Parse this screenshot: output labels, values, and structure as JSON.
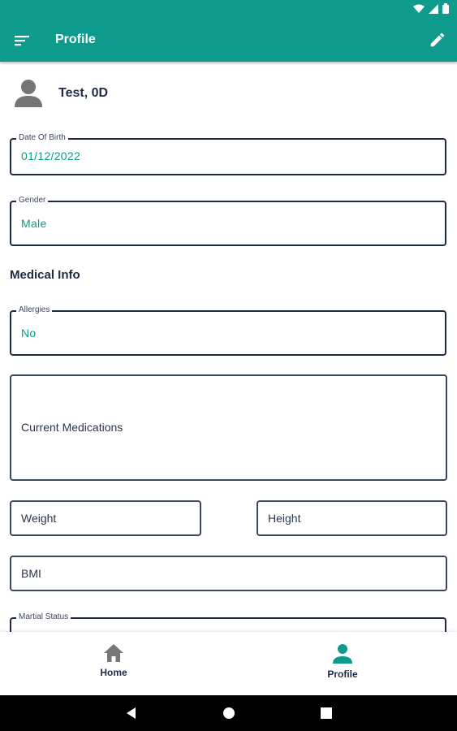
{
  "app_bar": {
    "title": "Profile",
    "menu_icon": "sort-lines-icon",
    "edit_icon": "pencil-icon"
  },
  "status_bar": {
    "icons": [
      "wifi-icon",
      "signal-icon",
      "battery-icon"
    ]
  },
  "user": {
    "name": "Test, 0D",
    "avatar_icon": "person-avatar-icon"
  },
  "fields": {
    "dob": {
      "label": "Date Of Birth",
      "value": "01/12/2022"
    },
    "gender": {
      "label": "Gender",
      "value": "Male"
    },
    "allergies": {
      "label": "Allergies",
      "value": "No"
    },
    "current_medications": {
      "placeholder": "Current Medications"
    },
    "weight": {
      "placeholder": "Weight"
    },
    "height": {
      "placeholder": "Height"
    },
    "bmi": {
      "placeholder": "BMI"
    },
    "martial_status": {
      "label": "Martial Status"
    }
  },
  "sections": {
    "medical_info": "Medical Info"
  },
  "bottom_nav": {
    "items": [
      {
        "label": "Home",
        "icon": "home-icon",
        "active": false
      },
      {
        "label": "Profile",
        "icon": "person-icon",
        "active": true
      }
    ]
  },
  "colors": {
    "primary": "#0e9a8c",
    "text_dark": "#1f2a44",
    "inactive_icon": "#777777"
  }
}
